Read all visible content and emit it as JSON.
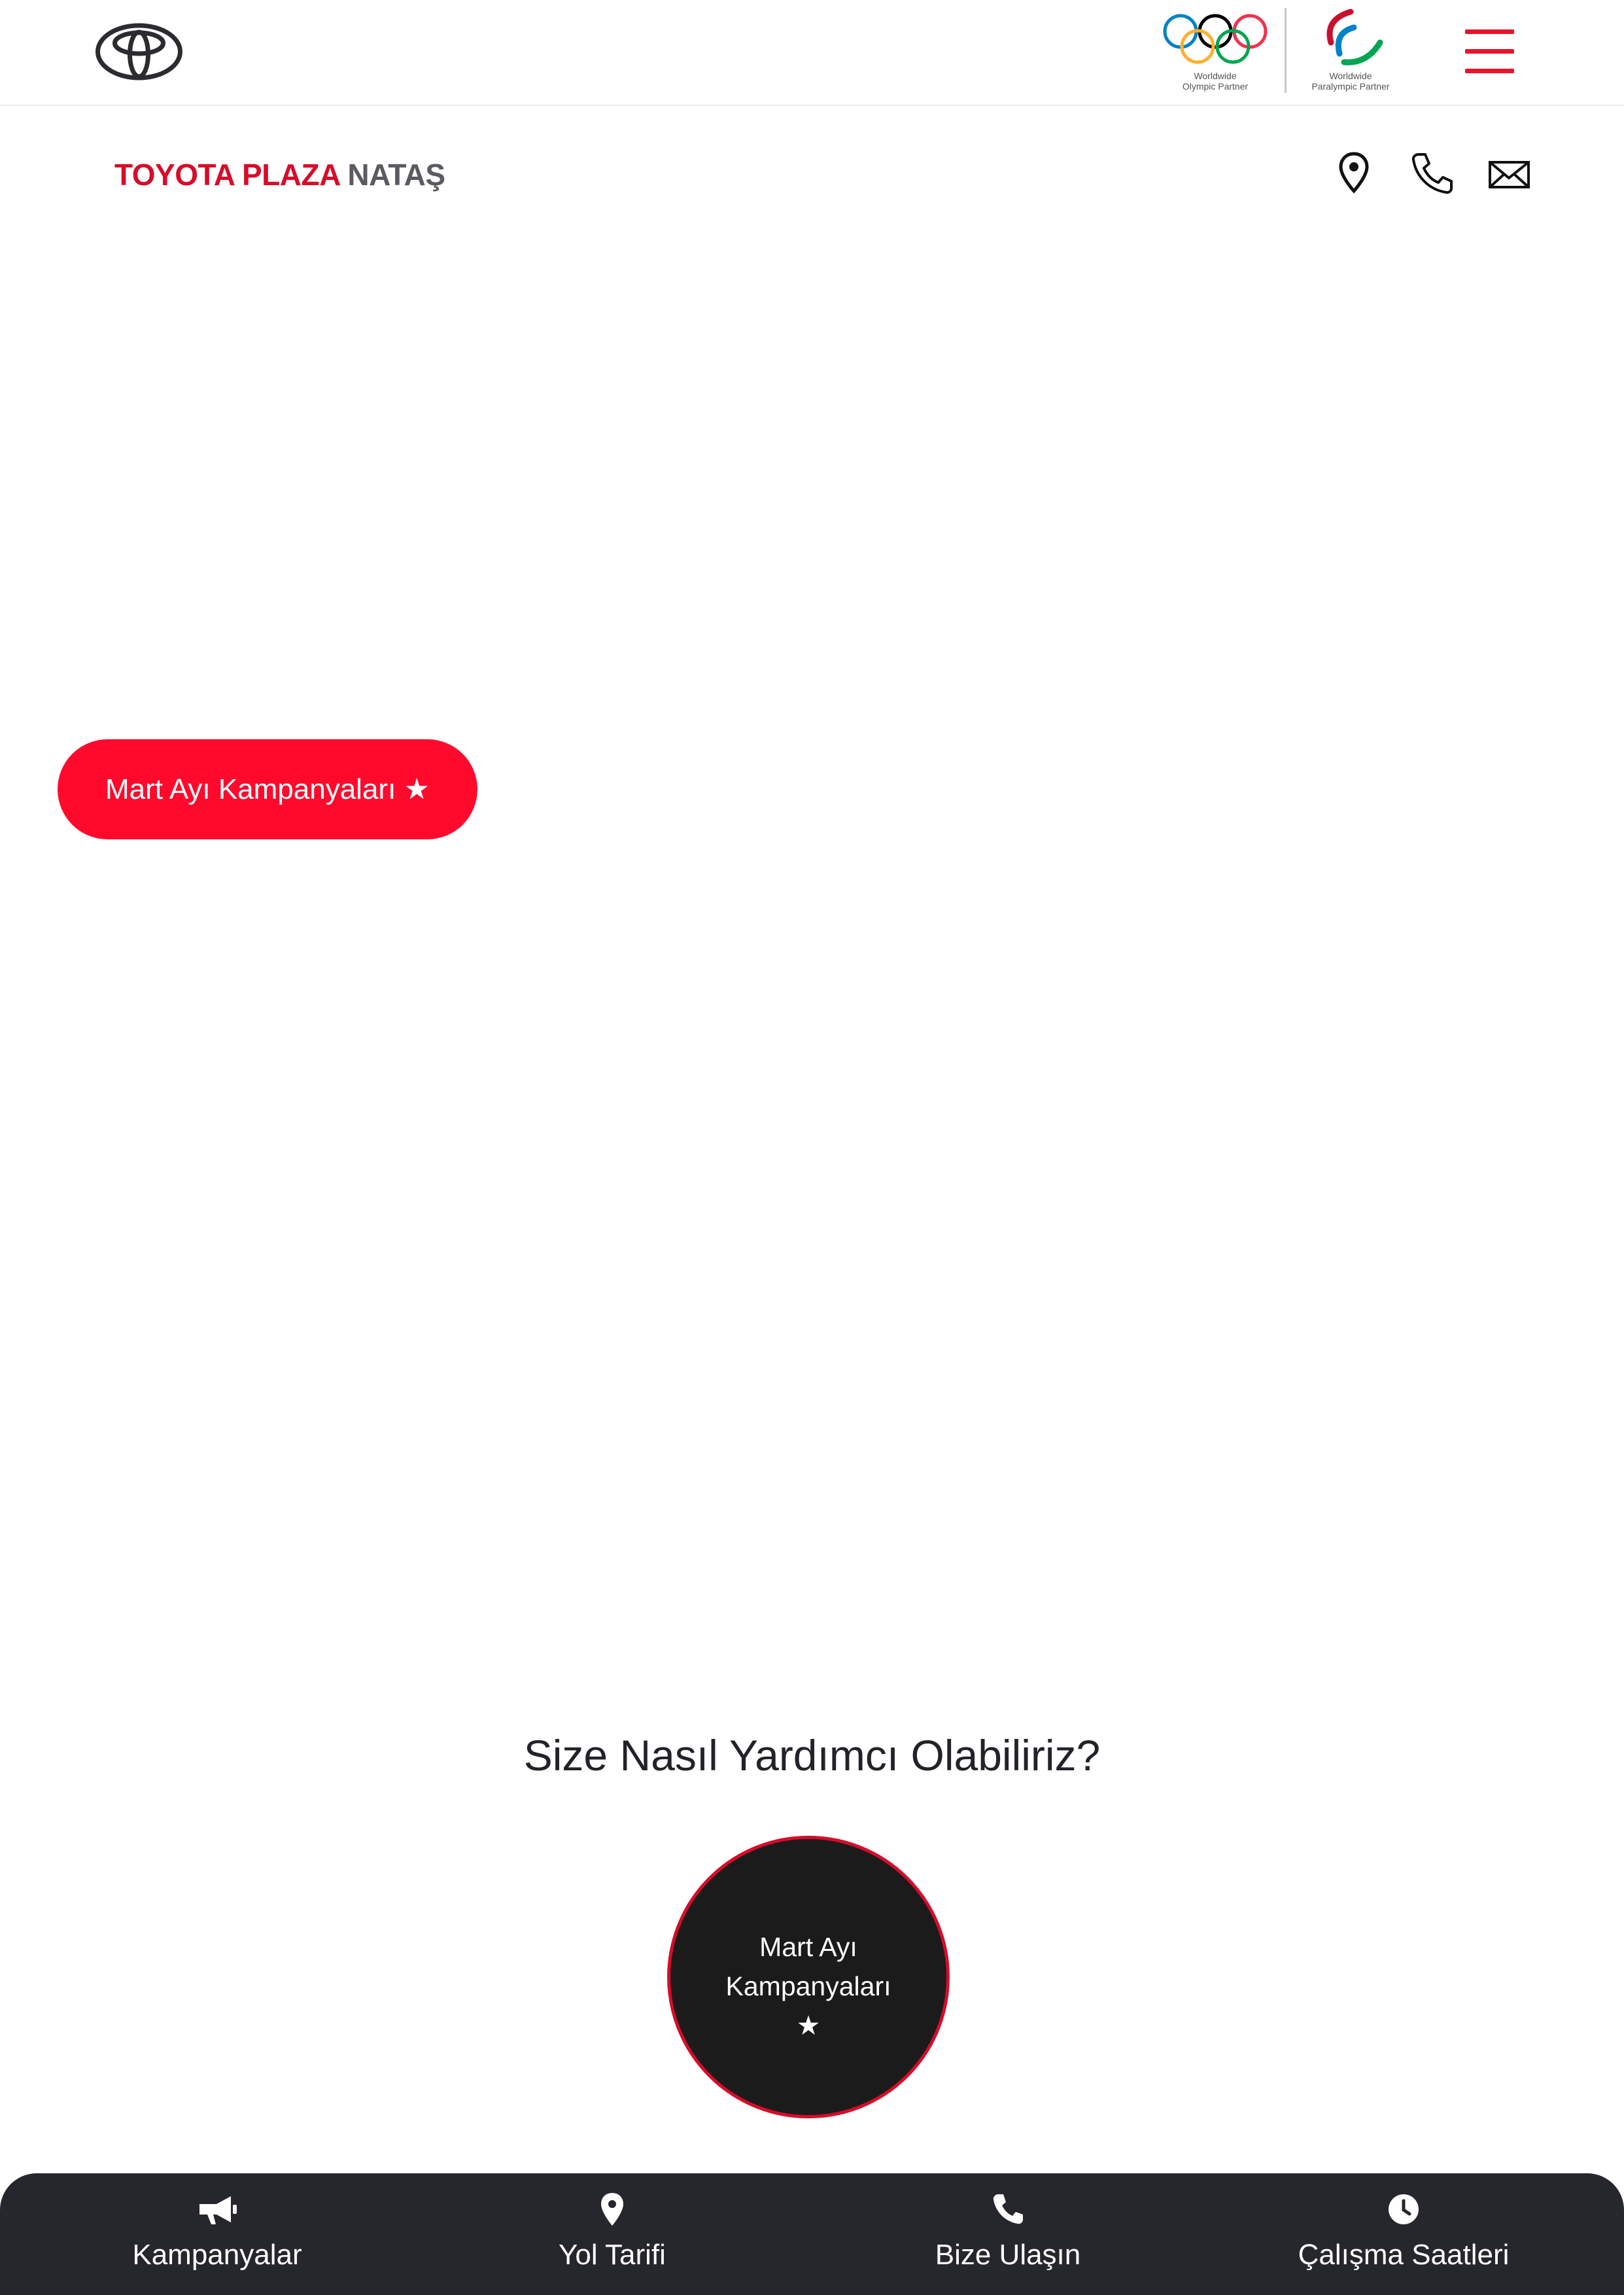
{
  "header": {
    "brand_logo_icon": "toyota-emblem-icon",
    "olympic_partner_line1": "Worldwide",
    "olympic_partner_line2": "Olympic Partner",
    "paralympic_partner_line1": "Worldwide",
    "paralympic_partner_line2": "Paralympic Partner",
    "menu_icon": "hamburger-menu-icon",
    "menu_color": "#e8142b"
  },
  "dealer": {
    "name_red": "TOYOTA PLAZA",
    "name_grey": "NATAŞ",
    "contact_icons": [
      "location-pin-icon",
      "phone-icon",
      "mail-icon"
    ],
    "accent_color": "#d70c2a"
  },
  "hero": {
    "cta_label": "Mart Ayı Kampanyaları ★",
    "cta_color": "#ff0a2d"
  },
  "help": {
    "title": "Size Nasıl Yardımcı Olabiliriz?",
    "circle_line1": "Mart Ayı",
    "circle_line2": "Kampanyaları",
    "circle_line3": "★"
  },
  "bottom_nav": {
    "background": "#26272d",
    "items": [
      {
        "label": "Kampanyalar",
        "icon": "megaphone-icon"
      },
      {
        "label": "Yol Tarifi",
        "icon": "location-pin-icon"
      },
      {
        "label": "Bize Ulaşın",
        "icon": "phone-icon"
      },
      {
        "label": "Çalışma Saatleri",
        "icon": "clock-icon"
      }
    ]
  }
}
